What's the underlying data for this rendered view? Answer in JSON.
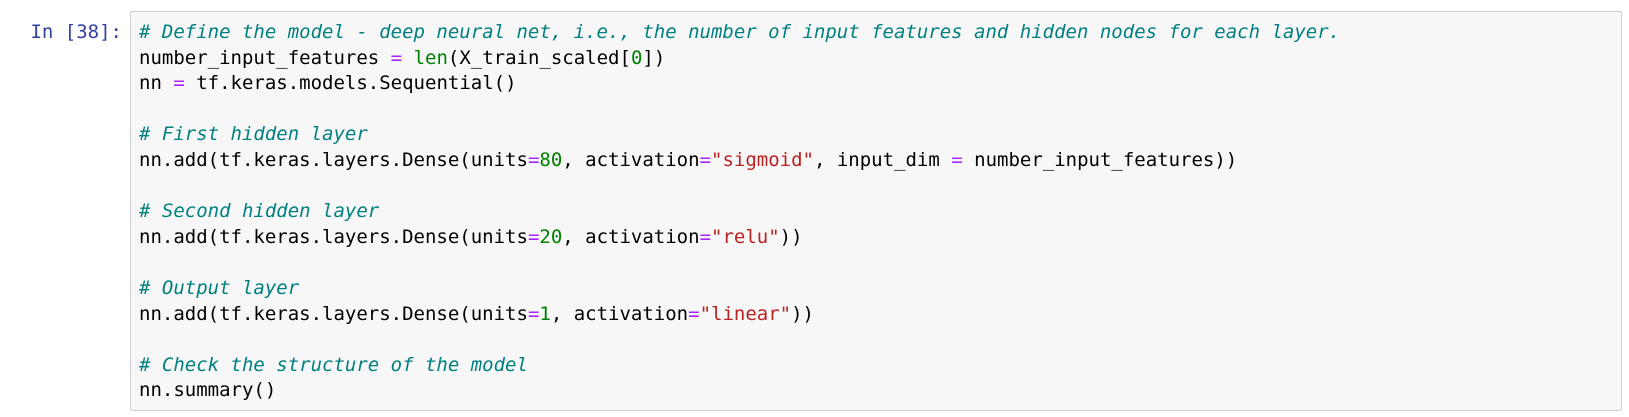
{
  "prompt": {
    "label": "In [38]:"
  },
  "cell": {
    "lines": [
      [
        {
          "t": "cm",
          "v": "# Define the model - deep neural net, i.e., the number of input features and hidden nodes for each layer."
        }
      ],
      [
        {
          "t": "pl",
          "v": "number_input_features "
        },
        {
          "t": "op",
          "v": "="
        },
        {
          "t": "pl",
          "v": " "
        },
        {
          "t": "bi",
          "v": "len"
        },
        {
          "t": "pl",
          "v": "(X_train_scaled["
        },
        {
          "t": "num",
          "v": "0"
        },
        {
          "t": "pl",
          "v": "])"
        }
      ],
      [
        {
          "t": "pl",
          "v": "nn "
        },
        {
          "t": "op",
          "v": "="
        },
        {
          "t": "pl",
          "v": " tf.keras.models.Sequential()"
        }
      ],
      [],
      [
        {
          "t": "cm",
          "v": "# First hidden layer"
        }
      ],
      [
        {
          "t": "pl",
          "v": "nn.add(tf.keras.layers.Dense(units"
        },
        {
          "t": "op",
          "v": "="
        },
        {
          "t": "num",
          "v": "80"
        },
        {
          "t": "pl",
          "v": ", activation"
        },
        {
          "t": "op",
          "v": "="
        },
        {
          "t": "str",
          "v": "\"sigmoid\""
        },
        {
          "t": "pl",
          "v": ", input_dim "
        },
        {
          "t": "op",
          "v": "="
        },
        {
          "t": "pl",
          "v": " number_input_features))"
        }
      ],
      [],
      [
        {
          "t": "cm",
          "v": "# Second hidden layer"
        }
      ],
      [
        {
          "t": "pl",
          "v": "nn.add(tf.keras.layers.Dense(units"
        },
        {
          "t": "op",
          "v": "="
        },
        {
          "t": "num",
          "v": "20"
        },
        {
          "t": "pl",
          "v": ", activation"
        },
        {
          "t": "op",
          "v": "="
        },
        {
          "t": "str",
          "v": "\"relu\""
        },
        {
          "t": "pl",
          "v": "))"
        }
      ],
      [],
      [
        {
          "t": "cm",
          "v": "# Output layer"
        }
      ],
      [
        {
          "t": "pl",
          "v": "nn.add(tf.keras.layers.Dense(units"
        },
        {
          "t": "op",
          "v": "="
        },
        {
          "t": "num",
          "v": "1"
        },
        {
          "t": "pl",
          "v": ", activation"
        },
        {
          "t": "op",
          "v": "="
        },
        {
          "t": "str",
          "v": "\"linear\""
        },
        {
          "t": "pl",
          "v": "))"
        }
      ],
      [],
      [
        {
          "t": "cm",
          "v": "# Check the structure of the model"
        }
      ],
      [
        {
          "t": "pl",
          "v": "nn.summary()"
        }
      ]
    ]
  }
}
